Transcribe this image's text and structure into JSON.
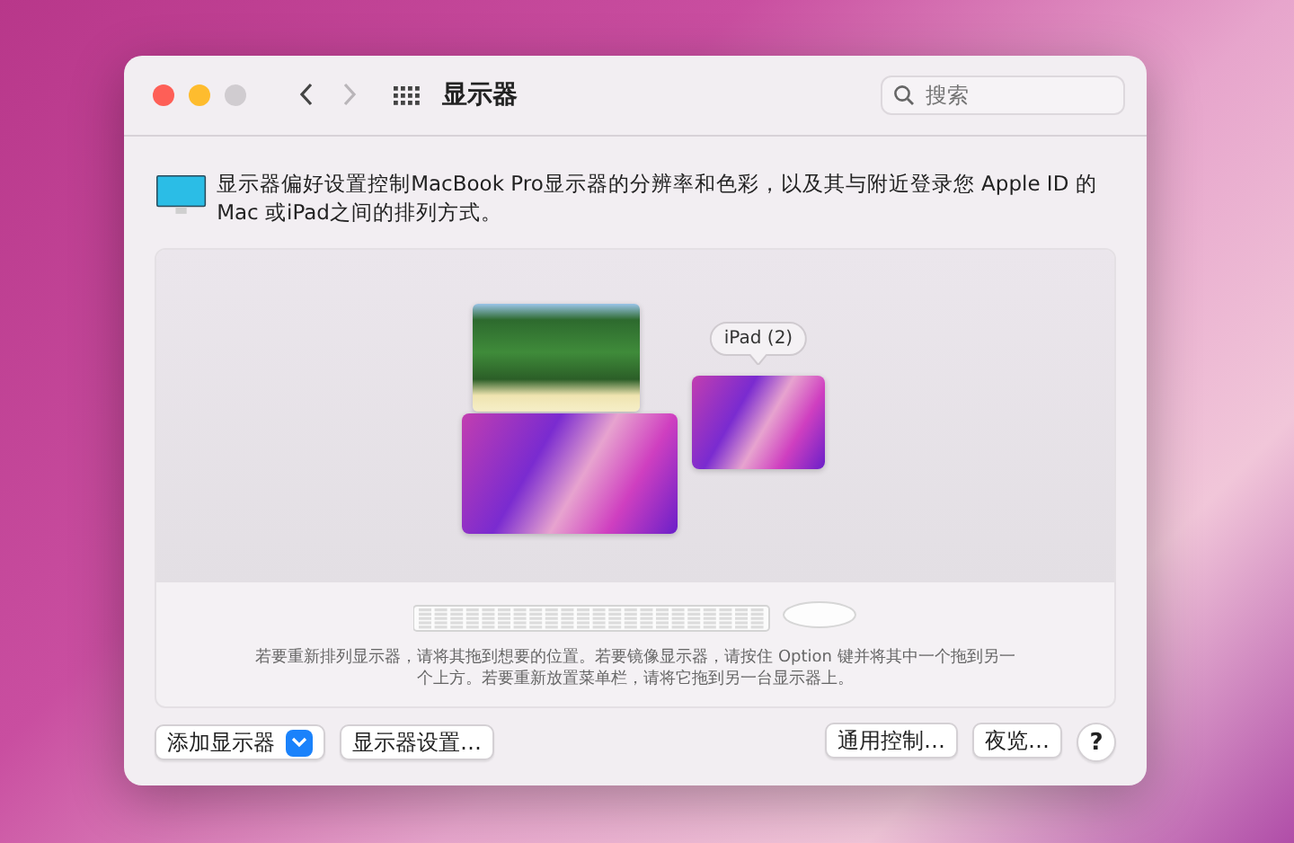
{
  "window": {
    "title": "显示器"
  },
  "nav": [
    {
      "kind": "back",
      "disabled": false
    },
    {
      "kind": "forward",
      "disabled": true
    }
  ],
  "search": {
    "placeholder": "搜索"
  },
  "description": "显示器偏好设置控制MacBook Pro显示器的分辨率和色彩，以及其与附近登录您 Apple ID 的 Mac 或iPad之间的排列方式。",
  "displays": [
    {
      "kind": "game-scene"
    },
    {
      "kind": "wallpaper"
    },
    {
      "kind": "wallpaper",
      "tooltip": "iPad (2)"
    }
  ],
  "hint": "若要重新排列显示器，请将其拖到想要的位置。若要镜像显示器，请按住 Option 键并将其中一个拖到另一个上方。若要重新放置菜单栏，请将它拖到另一台显示器上。",
  "buttons_left": [
    {
      "label": "添加显示器",
      "kind": "popup"
    },
    {
      "label": "显示器设置…",
      "kind": "push"
    }
  ],
  "buttons_right": [
    {
      "label": "通用控制…",
      "kind": "push"
    },
    {
      "label": "夜览…",
      "kind": "push"
    },
    {
      "label": "?",
      "kind": "help"
    }
  ]
}
